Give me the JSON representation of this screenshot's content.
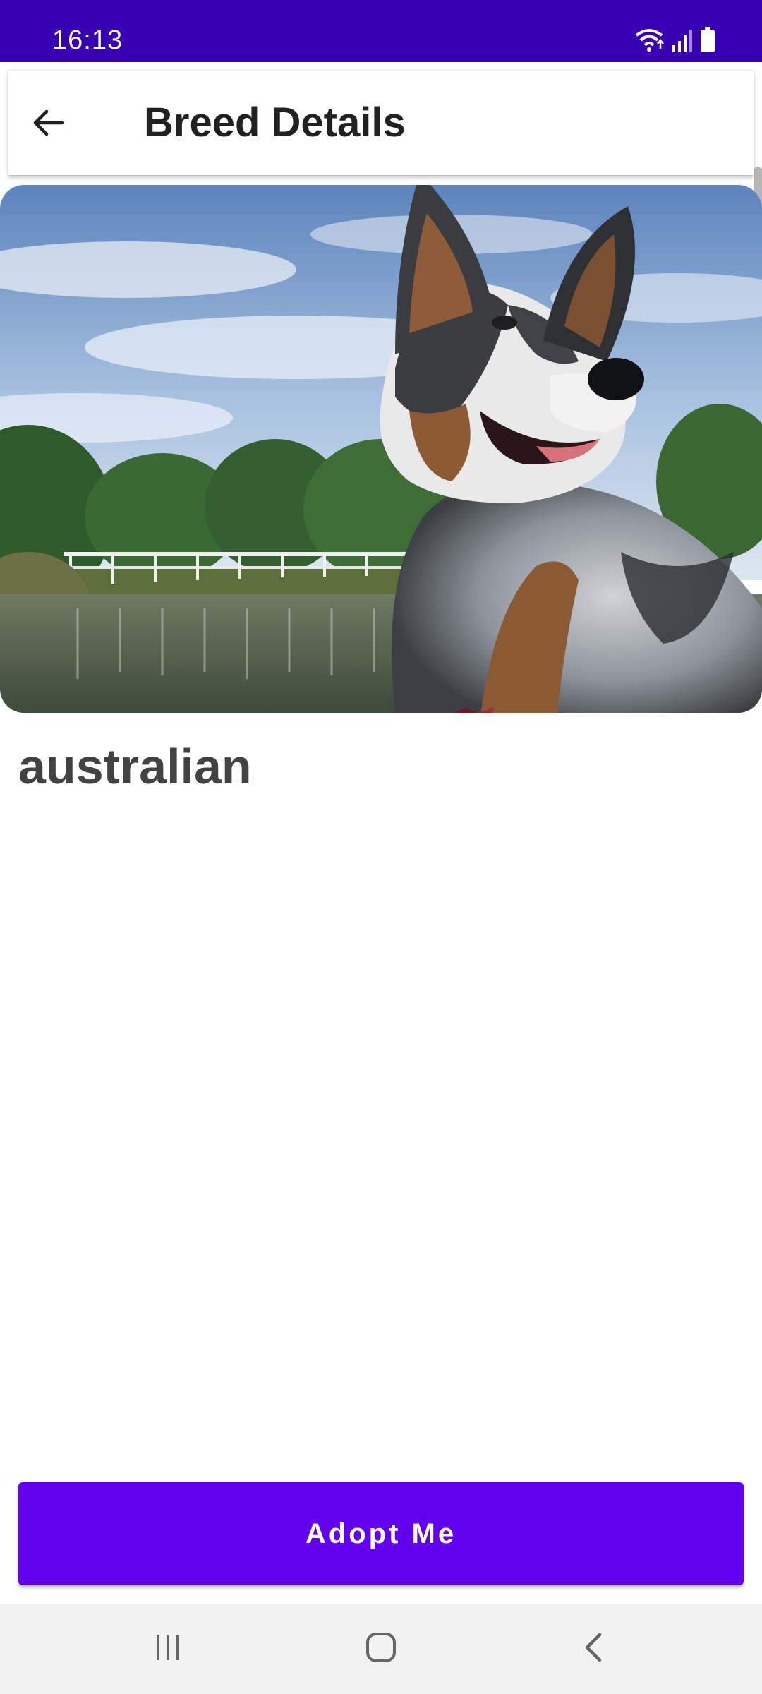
{
  "status_bar": {
    "time": "16:13",
    "icons": [
      "wifi-icon",
      "signal-icon",
      "battery-icon"
    ]
  },
  "app_bar": {
    "title": "Breed Details",
    "back_icon": "arrow-back-icon"
  },
  "breed": {
    "name": "australian",
    "image_icon": "dog-photo"
  },
  "actions": {
    "adopt_label": "Adopt Me"
  },
  "nav_bar": {
    "buttons": [
      "recents-icon",
      "home-icon",
      "back-icon"
    ]
  },
  "colors": {
    "status_bar": "#3700b3",
    "primary": "#6200ee",
    "title_text": "#212121",
    "breed_text": "#424242",
    "nav_bar": "#f2f2f2"
  }
}
